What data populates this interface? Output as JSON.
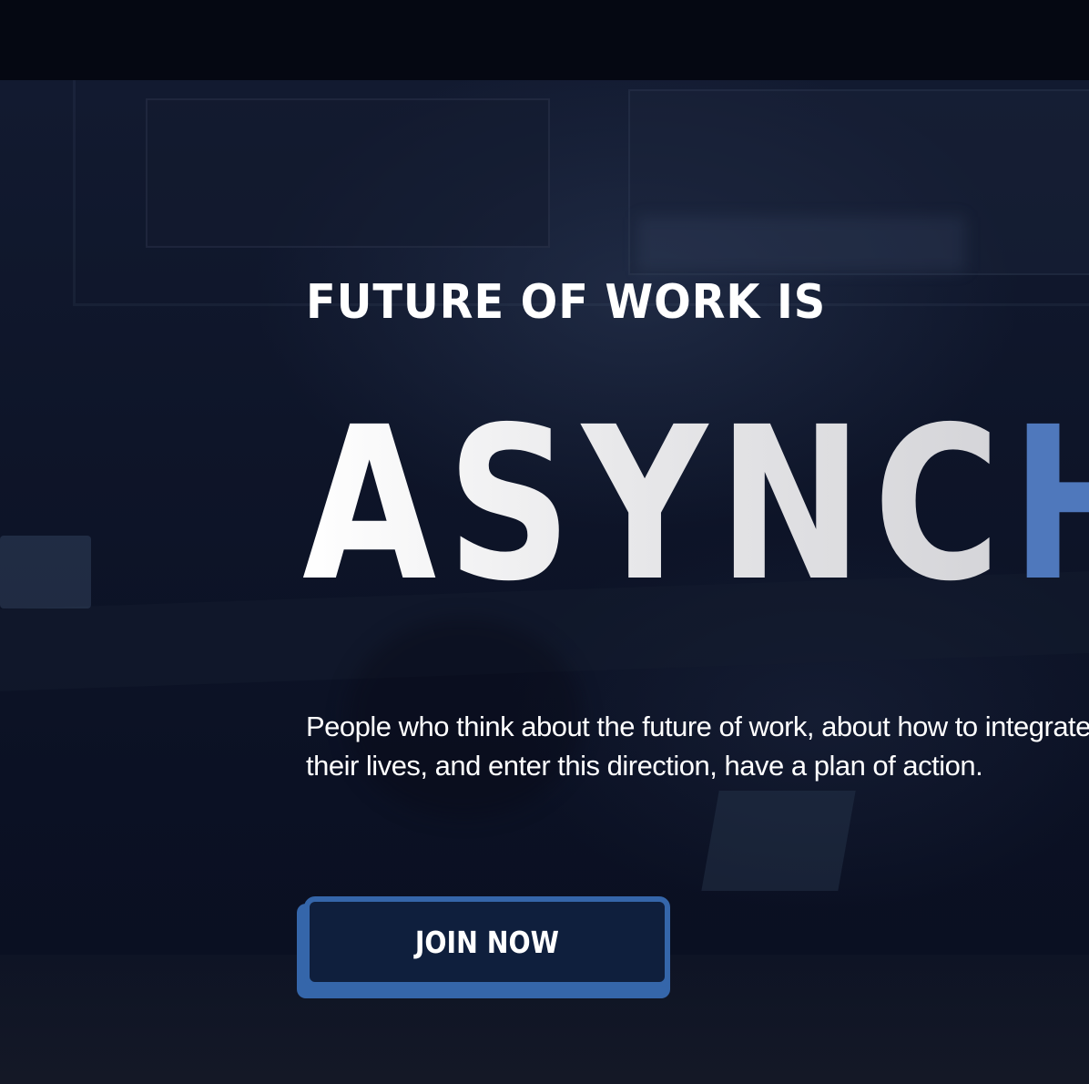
{
  "hero": {
    "eyebrow": "FUTURE OF WORK IS",
    "headline_main": "ASYNC",
    "headline_accent": "HRONOUS",
    "description": "People who think about the future of work, about how to integrate work into their lives, and enter this direction, have a plan of action.",
    "cta_label": "JOIN NOW"
  },
  "colors": {
    "accent": "#4f78bc",
    "button_border": "#3566aa",
    "button_fill": "#0f1f3d",
    "background": "#0a1024",
    "top_bar": "#050812"
  }
}
